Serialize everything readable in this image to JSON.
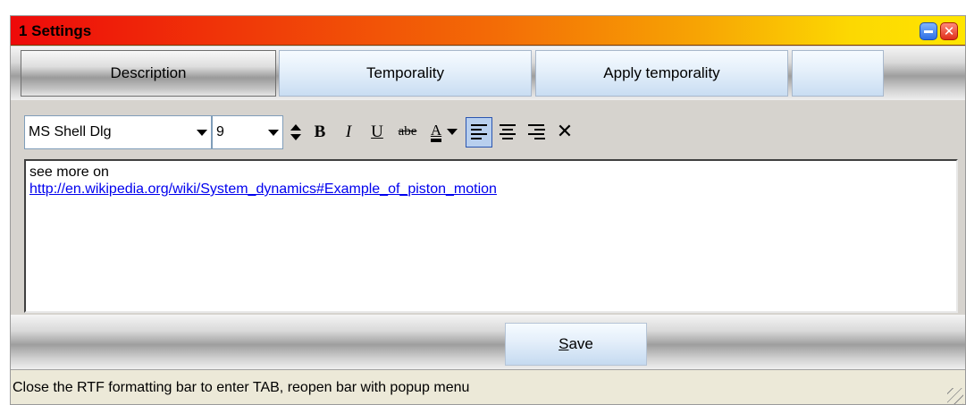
{
  "window": {
    "title": "1  Settings",
    "minimize_icon": "minimize-icon",
    "close_icon": "close-icon",
    "close_glyph": "✕"
  },
  "tabs": [
    {
      "label": "Description",
      "active": true
    },
    {
      "label": "Temporality",
      "active": false
    },
    {
      "label": "Apply temporality",
      "active": false
    },
    {
      "label": "",
      "active": false
    }
  ],
  "toolbar": {
    "font_name": "MS Shell Dlg",
    "font_size": "9",
    "bold": "B",
    "italic": "I",
    "underline": "U",
    "strike": "abe",
    "font_color": "A",
    "clear": "✕",
    "alignment": "left"
  },
  "editor": {
    "line1": "see more on",
    "link": "http://en.wikipedia.org/wiki/System_dynamics#Example_of_piston_motion"
  },
  "save": {
    "mnemonic": "S",
    "rest": "ave"
  },
  "status": {
    "text": "Close the RTF formatting bar to enter TAB, reopen bar with popup menu"
  },
  "colors": {
    "title_gradient_start": "#ee0a0a",
    "title_gradient_end": "#ffe500",
    "link": "#0000ee"
  }
}
